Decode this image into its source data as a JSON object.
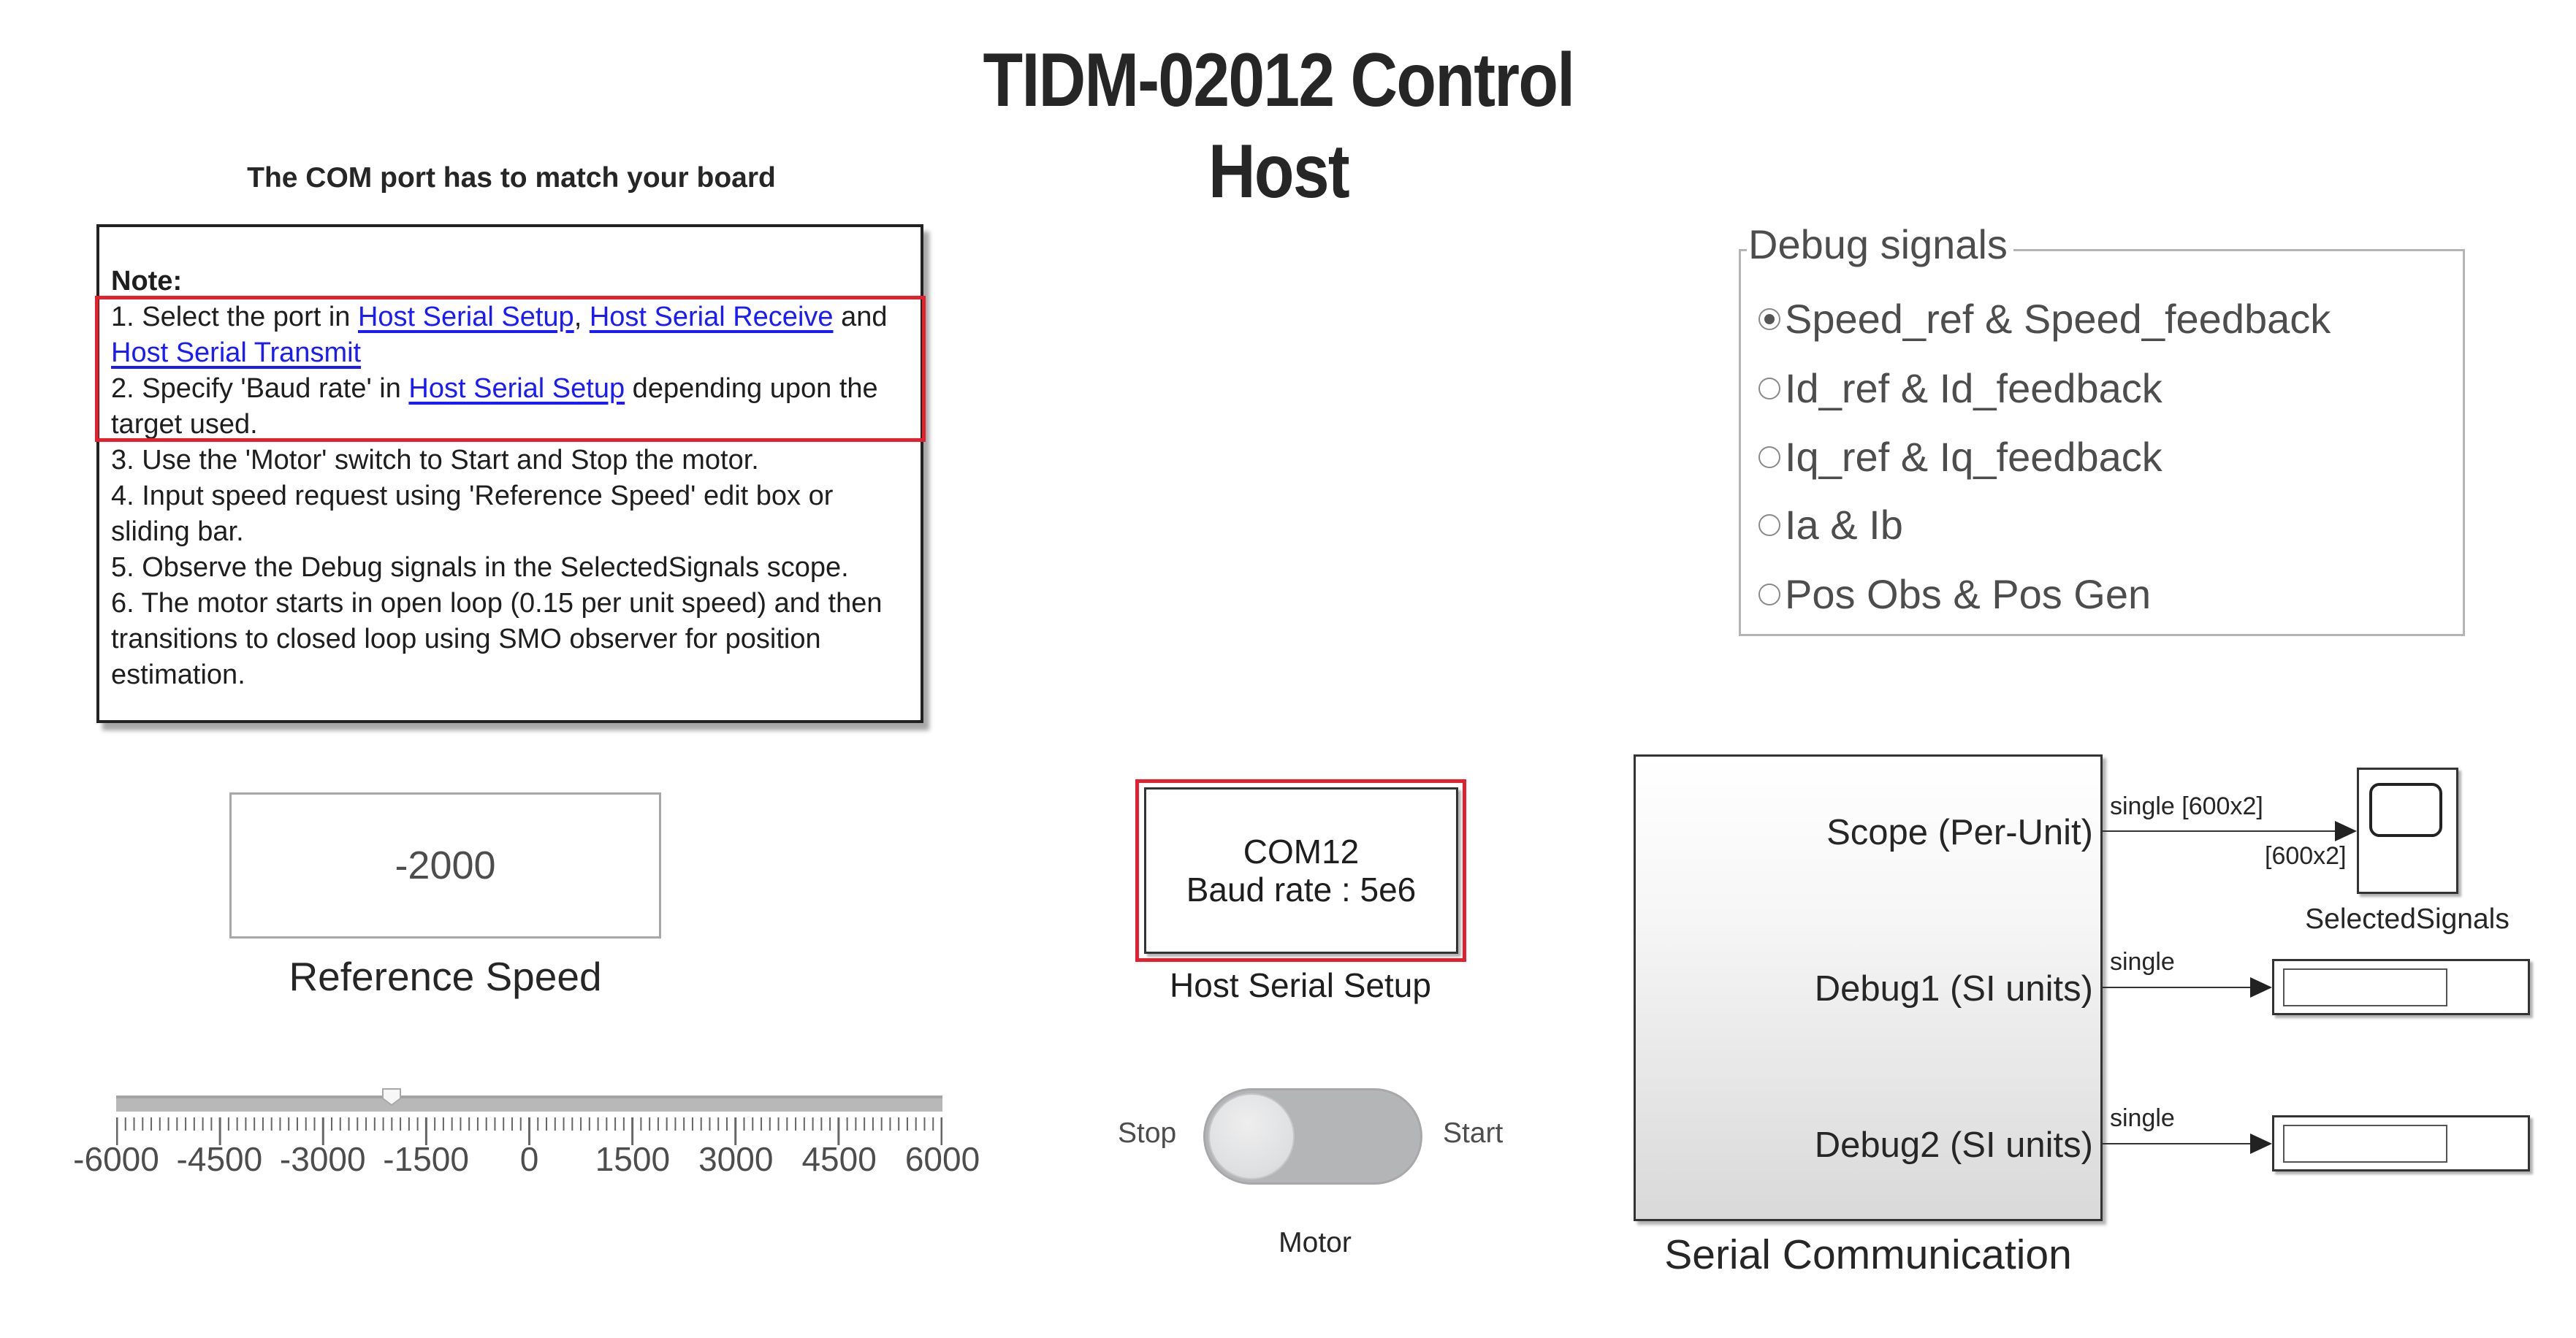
{
  "title": {
    "line1": "TIDM-02012 Control",
    "line2": "Host"
  },
  "com_hint": "The COM port has to match your board",
  "note": {
    "heading": "Note:",
    "lines": [
      {
        "parts": [
          {
            "t": "1. Select the port in "
          },
          {
            "t": "Host Serial Setup",
            "link": true
          },
          {
            "t": ", "
          },
          {
            "t": "Host Serial Receive",
            "link": true
          },
          {
            "t": " and"
          }
        ]
      },
      {
        "parts": [
          {
            "t": "Host Serial Transmit",
            "link": true
          }
        ]
      },
      {
        "parts": [
          {
            "t": "2. Specify 'Baud rate' in "
          },
          {
            "t": "Host Serial Setup",
            "link": true
          },
          {
            "t": " depending upon the"
          }
        ]
      },
      {
        "parts": [
          {
            "t": "target used."
          }
        ]
      },
      {
        "parts": [
          {
            "t": "3. Use the 'Motor' switch to Start and Stop the motor."
          }
        ]
      },
      {
        "parts": [
          {
            "t": "4. Input speed request using 'Reference Speed' edit box or"
          }
        ]
      },
      {
        "parts": [
          {
            "t": "sliding bar."
          }
        ]
      },
      {
        "parts": [
          {
            "t": "5. Observe the Debug signals in the SelectedSignals scope."
          }
        ]
      },
      {
        "parts": [
          {
            "t": "6.  The motor starts in open loop (0.15 per unit speed)  and then"
          }
        ]
      },
      {
        "parts": [
          {
            "t": "transitions to closed loop using SMO observer for position"
          }
        ]
      },
      {
        "parts": [
          {
            "t": "estimation."
          }
        ]
      }
    ]
  },
  "debug_signals": {
    "legend": "Debug signals",
    "selected_index": 0,
    "options": [
      "Speed_ref & Speed_feedback",
      "Id_ref & Id_feedback",
      "Iq_ref & Iq_feedback",
      "Ia & Ib",
      "Pos Obs & Pos Gen"
    ]
  },
  "reference_speed": {
    "value": "-2000",
    "label": "Reference Speed"
  },
  "speed_slider": {
    "min": -6000,
    "max": 6000,
    "value": -2000,
    "major_step": 1500,
    "minor_per_major": 12,
    "tick_labels": [
      "-6000",
      "-4500",
      "-3000",
      "-1500",
      "0",
      "1500",
      "3000",
      "4500",
      "6000"
    ]
  },
  "host_serial_setup": {
    "port": "COM12",
    "baud": "Baud rate : 5e6",
    "label": "Host Serial Setup"
  },
  "motor_switch": {
    "off_label": "Stop",
    "on_label": "Start",
    "label": "Motor",
    "state": "Stop"
  },
  "serial_comm": {
    "label": "Serial Communication",
    "ports": [
      {
        "name": "Scope (Per-Unit)",
        "signal": "single [600x2]",
        "dims": "[600x2]"
      },
      {
        "name": "Debug1 (SI units)",
        "signal": "single"
      },
      {
        "name": "Debug2 (SI units)",
        "signal": "single"
      }
    ]
  },
  "scope": {
    "label": "SelectedSignals"
  },
  "colors": {
    "highlight_red": "#e3202b",
    "link_blue": "#1a1aff",
    "text_dark": "#262626",
    "text_gray": "#4d4d4d"
  }
}
